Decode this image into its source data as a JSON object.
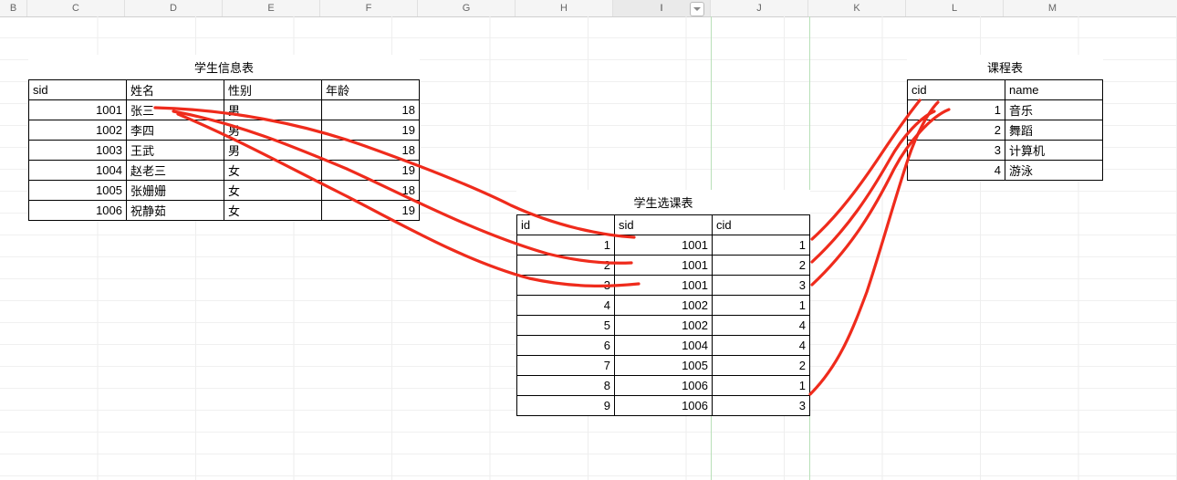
{
  "columns": [
    "B",
    "C",
    "D",
    "E",
    "F",
    "G",
    "H",
    "I",
    "J",
    "K",
    "L",
    "M"
  ],
  "selected_column": "I",
  "students": {
    "title": "学生信息表",
    "headers": {
      "sid": "sid",
      "name": "姓名",
      "gender": "性别",
      "age": "年龄"
    },
    "rows": [
      {
        "sid": "1001",
        "name": "张三",
        "gender": "男",
        "age": "18"
      },
      {
        "sid": "1002",
        "name": "李四",
        "gender": "男",
        "age": "19"
      },
      {
        "sid": "1003",
        "name": "王武",
        "gender": "男",
        "age": "18"
      },
      {
        "sid": "1004",
        "name": "赵老三",
        "gender": "女",
        "age": "19"
      },
      {
        "sid": "1005",
        "name": "张姗姗",
        "gender": "女",
        "age": "18"
      },
      {
        "sid": "1006",
        "name": "祝静茹",
        "gender": "女",
        "age": "19"
      }
    ]
  },
  "courses": {
    "title": "课程表",
    "headers": {
      "cid": "cid",
      "name": "name"
    },
    "rows": [
      {
        "cid": "1",
        "name": "音乐"
      },
      {
        "cid": "2",
        "name": "舞蹈"
      },
      {
        "cid": "3",
        "name": "计算机"
      },
      {
        "cid": "4",
        "name": "游泳"
      }
    ]
  },
  "enroll": {
    "title": "学生选课表",
    "headers": {
      "id": "id",
      "sid": "sid",
      "cid": "cid"
    },
    "rows": [
      {
        "id": "1",
        "sid": "1001",
        "cid": "1"
      },
      {
        "id": "2",
        "sid": "1001",
        "cid": "2"
      },
      {
        "id": "3",
        "sid": "1001",
        "cid": "3"
      },
      {
        "id": "4",
        "sid": "1002",
        "cid": "1"
      },
      {
        "id": "5",
        "sid": "1002",
        "cid": "4"
      },
      {
        "id": "6",
        "sid": "1004",
        "cid": "4"
      },
      {
        "id": "7",
        "sid": "1005",
        "cid": "2"
      },
      {
        "id": "8",
        "sid": "1006",
        "cid": "1"
      },
      {
        "id": "9",
        "sid": "1006",
        "cid": "3"
      }
    ]
  }
}
